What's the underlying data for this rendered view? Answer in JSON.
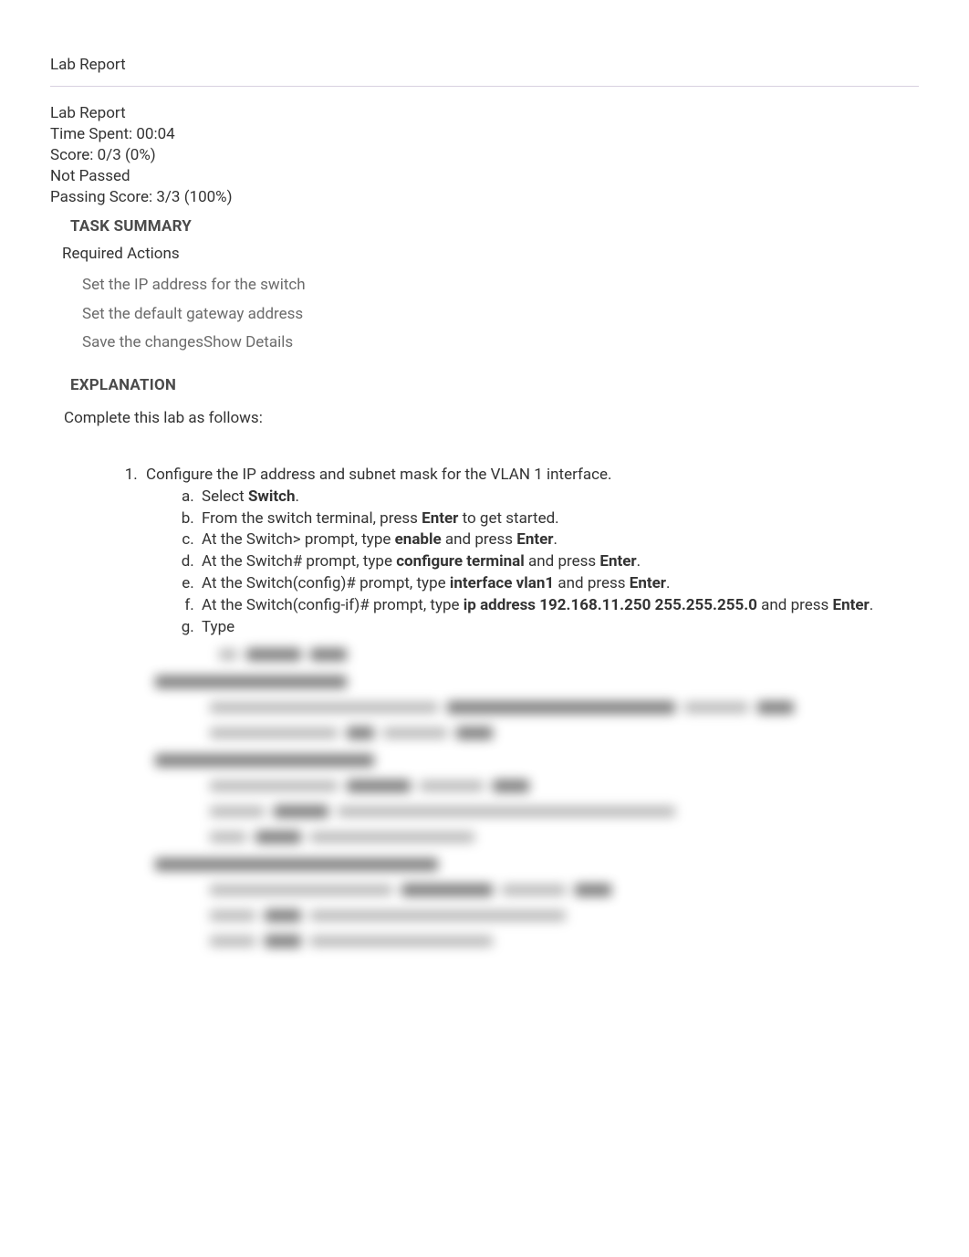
{
  "title": "Lab Report",
  "header": {
    "title": "Lab Report",
    "timeSpentLabel": "Time Spent: ",
    "timeSpentValue": "00:04",
    "scoreLabel": "Score: ",
    "scoreValue": "0/3 (0%)",
    "status": " Not Passed",
    "passingLabel": "Passing Score: ",
    "passingValue": "3/3 (100%)"
  },
  "sections": {
    "taskSummary": "TASK SUMMARY",
    "requiredActions": "Required Actions",
    "explanation": "EXPLANATION"
  },
  "actions": [
    "Set the IP address for the switch",
    "Set the default gateway address",
    "Save the changes"
  ],
  "showDetails": "Show Details",
  "completeText": "Complete this lab as follows:",
  "step1": {
    "title": "Configure the IP address and subnet mask for the VLAN 1 interface.",
    "a1": "Select ",
    "a2": "Switch",
    "a3": ".",
    "b1": "From the switch terminal, press ",
    "b2": "Enter",
    "b3": " to get started.",
    "c1": "At the Switch> prompt, type ",
    "c2": "enable",
    "c3": " and press ",
    "c4": "Enter",
    "c5": ".",
    "d1": "At the Switch# prompt, type ",
    "d2": "configure terminal",
    "d3": " and press ",
    "d4": "Enter",
    "d5": ".",
    "e1": "At the Switch(config)# prompt, type ",
    "e2": "interface vlan1",
    "e3": " and press ",
    "e4": "Enter",
    "e5": ".",
    "f1": "At the Switch(config-if)# prompt, type ",
    "f2": "ip address 192.168.11.250 255.255.255.0",
    "f3": " and press ",
    "f4": "Enter",
    "f5": ".",
    "g1": "Type "
  }
}
